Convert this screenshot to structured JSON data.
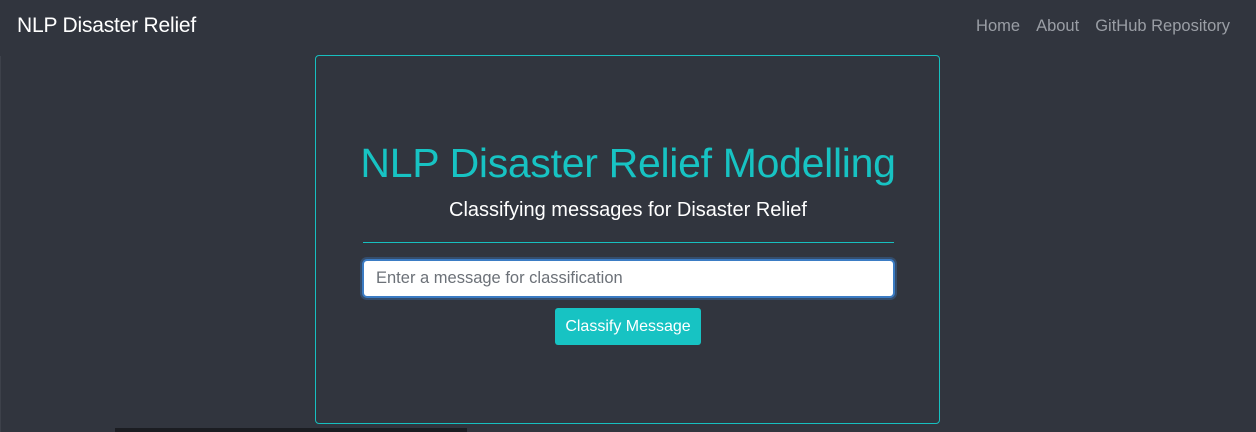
{
  "navbar": {
    "brand": "NLP Disaster Relief",
    "links": [
      "Home",
      "About",
      "GitHub Repository"
    ]
  },
  "main": {
    "title": "NLP Disaster Relief Modelling",
    "subtitle": "Classifying messages for Disaster Relief",
    "input_value": "",
    "input_placeholder": "Enter a message for classification",
    "button_label": "Classify Message"
  },
  "colors": {
    "background": "#31353e",
    "accent": "#17c3c3",
    "nav_link": "#9a9ea5",
    "input_focus_border": "#3b7cc4"
  }
}
